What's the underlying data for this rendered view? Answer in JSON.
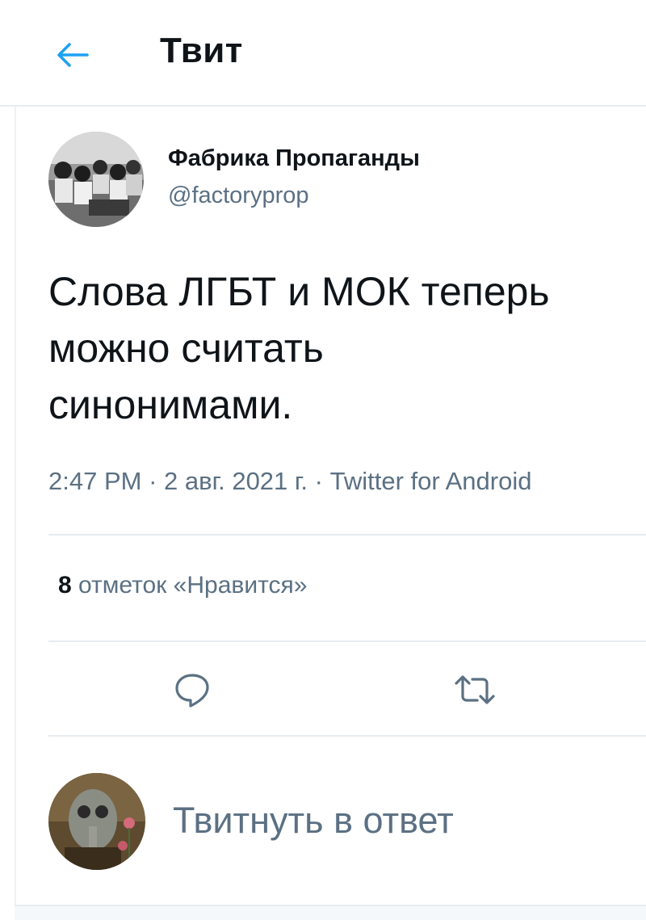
{
  "header": {
    "back_icon": "arrow-left-icon",
    "title": "Твит"
  },
  "tweet": {
    "author_name": "Фабрика Пропаганды",
    "author_handle": "@factoryprop",
    "text": "Слова ЛГБТ и МОК теперь\nможно считать\nсинонимами.",
    "time": "2:47 PM",
    "date": "2 авг. 2021 г.",
    "source": "Twitter for Android",
    "separator": " · ",
    "likes_count": "8",
    "likes_label": "отметок «Нравится»"
  },
  "actions": [
    {
      "name": "reply",
      "icon": "comment-icon"
    },
    {
      "name": "retweet",
      "icon": "retweet-icon"
    }
  ],
  "reply_bar": {
    "placeholder": "Твитнуть в ответ"
  },
  "colors": {
    "accent": "#1da1f2",
    "text_primary": "#0f1419",
    "text_secondary": "#5b7083",
    "divider": "#e6ecf0"
  }
}
